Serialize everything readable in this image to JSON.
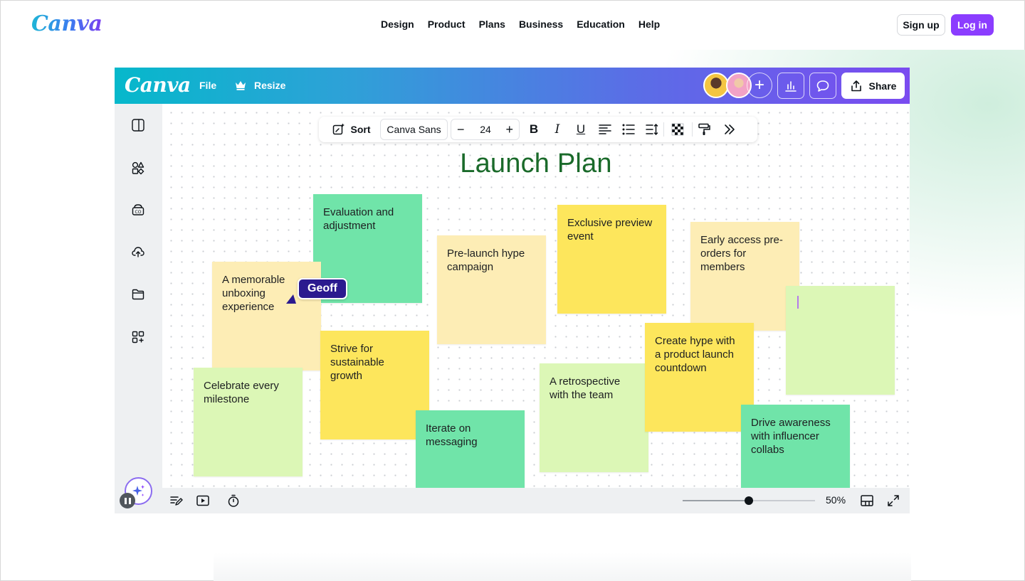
{
  "site": {
    "logo": "Canva",
    "nav": [
      "Design",
      "Product",
      "Plans",
      "Business",
      "Education",
      "Help"
    ],
    "signup_label": "Sign up",
    "login_label": "Log in"
  },
  "editor": {
    "logo": "Canva",
    "file_label": "File",
    "resize_label": "Resize",
    "share_label": "Share",
    "toolbar": {
      "sort_label": "Sort",
      "font_name": "Canva Sans",
      "font_size": "24",
      "more_icon": "chevrons-right-icon"
    },
    "board_title": "Launch Plan",
    "notes": [
      {
        "text": "Evaluation and adjustment",
        "color": "#70e4a9"
      },
      {
        "text": "A memorable unboxing experience",
        "color": "#fdedb5"
      },
      {
        "text": "Pre-launch hype campaign",
        "color": "#fdedb5"
      },
      {
        "text": "Exclusive preview event",
        "color": "#fde65c"
      },
      {
        "text": "Early access pre-orders for members",
        "color": "#fdedb5"
      },
      {
        "text": "",
        "color": "#dcf7b6"
      },
      {
        "text": "Strive for sustainable growth",
        "color": "#fde65c"
      },
      {
        "text": "Celebrate every milestone",
        "color": "#dcf7b6"
      },
      {
        "text": "Iterate on messaging",
        "color": "#70e4a9"
      },
      {
        "text": "A retrospective with the team",
        "color": "#dcf7b6"
      },
      {
        "text": "Create hype with a product launch countdown",
        "color": "#fde65c"
      },
      {
        "text": "Drive awareness with influencer collabs",
        "color": "#70e4a9"
      }
    ],
    "collaborator_tag": "Geoff",
    "zoom": {
      "label": "50%",
      "value": 0.5
    }
  },
  "colors": {
    "brand_purple": "#8b3dff",
    "title_green": "#1a6a2a",
    "tag_bg": "#2b1a8f"
  }
}
